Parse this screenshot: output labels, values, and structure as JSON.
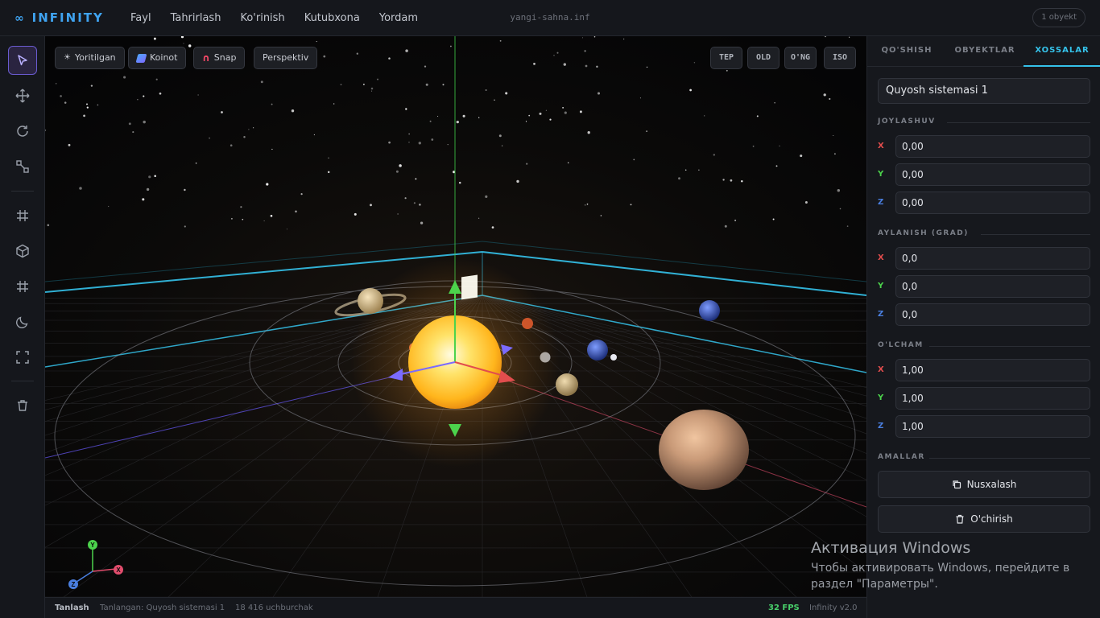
{
  "app": {
    "name": "INFINITY",
    "logo_glyph": "∞",
    "scene_file": "yangi-sahna.inf",
    "object_count": "1 obyekt"
  },
  "menu": [
    "Fayl",
    "Tahrirlash",
    "Ko'rinish",
    "Kutubxona",
    "Yordam"
  ],
  "left_tools": [
    {
      "name": "select-tool",
      "icon": "cursor-arrow-icon",
      "active": true
    },
    {
      "name": "move-tool",
      "icon": "move-arrows-icon"
    },
    {
      "name": "rotate-tool",
      "icon": "rotate-icon"
    },
    {
      "name": "scale-tool",
      "icon": "scale-icon"
    },
    {
      "name": "grid-tool",
      "icon": "grid-icon"
    },
    {
      "name": "object-tool",
      "icon": "cube-icon"
    },
    {
      "name": "grid-alt-tool",
      "icon": "hash-icon"
    },
    {
      "name": "dark-mode-tool",
      "icon": "moon-icon"
    },
    {
      "name": "fullscreen-tool",
      "icon": "fullscreen-icon"
    },
    {
      "name": "delete-tool",
      "icon": "trash-icon"
    }
  ],
  "viewport": {
    "toggles": [
      {
        "label": "Yoritilgan",
        "icon": "sun-icon"
      },
      {
        "label": "Koinot",
        "icon": "galaxy-icon"
      },
      {
        "label": "Snap",
        "icon": "magnet-icon"
      },
      {
        "label": "Perspektiv",
        "icon": ""
      }
    ],
    "views": [
      "TEP",
      "OLD",
      "O'NG",
      "ISO"
    ],
    "gizmo_labels": {
      "x": "X",
      "y": "Y",
      "z": "Z"
    },
    "colors": {
      "x_axis": "#e24d4d",
      "y_axis": "#4cd34c",
      "z_axis": "#6a5bff",
      "accent": "#35c2ea",
      "sun": "#ffd23a"
    }
  },
  "status": {
    "mode": "Tanlash",
    "selected": "Tanlangan: Quyosh sistemasi 1",
    "triangles": "18 416 uchburchak",
    "fps": "32 FPS",
    "version": "Infinity v2.0"
  },
  "panel": {
    "tabs": [
      "QO'SHISH",
      "OBYEKTLAR",
      "XOSSALAR"
    ],
    "active_tab": "XOSSALAR",
    "object_name": "Quyosh sistemasi 1",
    "position": {
      "title": "JOYLASHUV",
      "x": "0,00",
      "y": "0,00",
      "z": "0,00"
    },
    "rotation": {
      "title": "AYLANISH (GRAD)",
      "x": "0,0",
      "y": "0,0",
      "z": "0,0"
    },
    "scale": {
      "title": "O'LCHAM",
      "x": "1,00",
      "y": "1,00",
      "z": "1,00"
    },
    "actions": {
      "title": "AMALLAR",
      "duplicate": "Nusxalash",
      "delete": "O'chirish"
    },
    "axis_labels": {
      "x": "X",
      "y": "Y",
      "z": "Z"
    }
  },
  "watermark": {
    "title": "Активация Windows",
    "line1": "Чтобы активировать Windows, перейдите в",
    "line2": "раздел \"Параметры\"."
  }
}
